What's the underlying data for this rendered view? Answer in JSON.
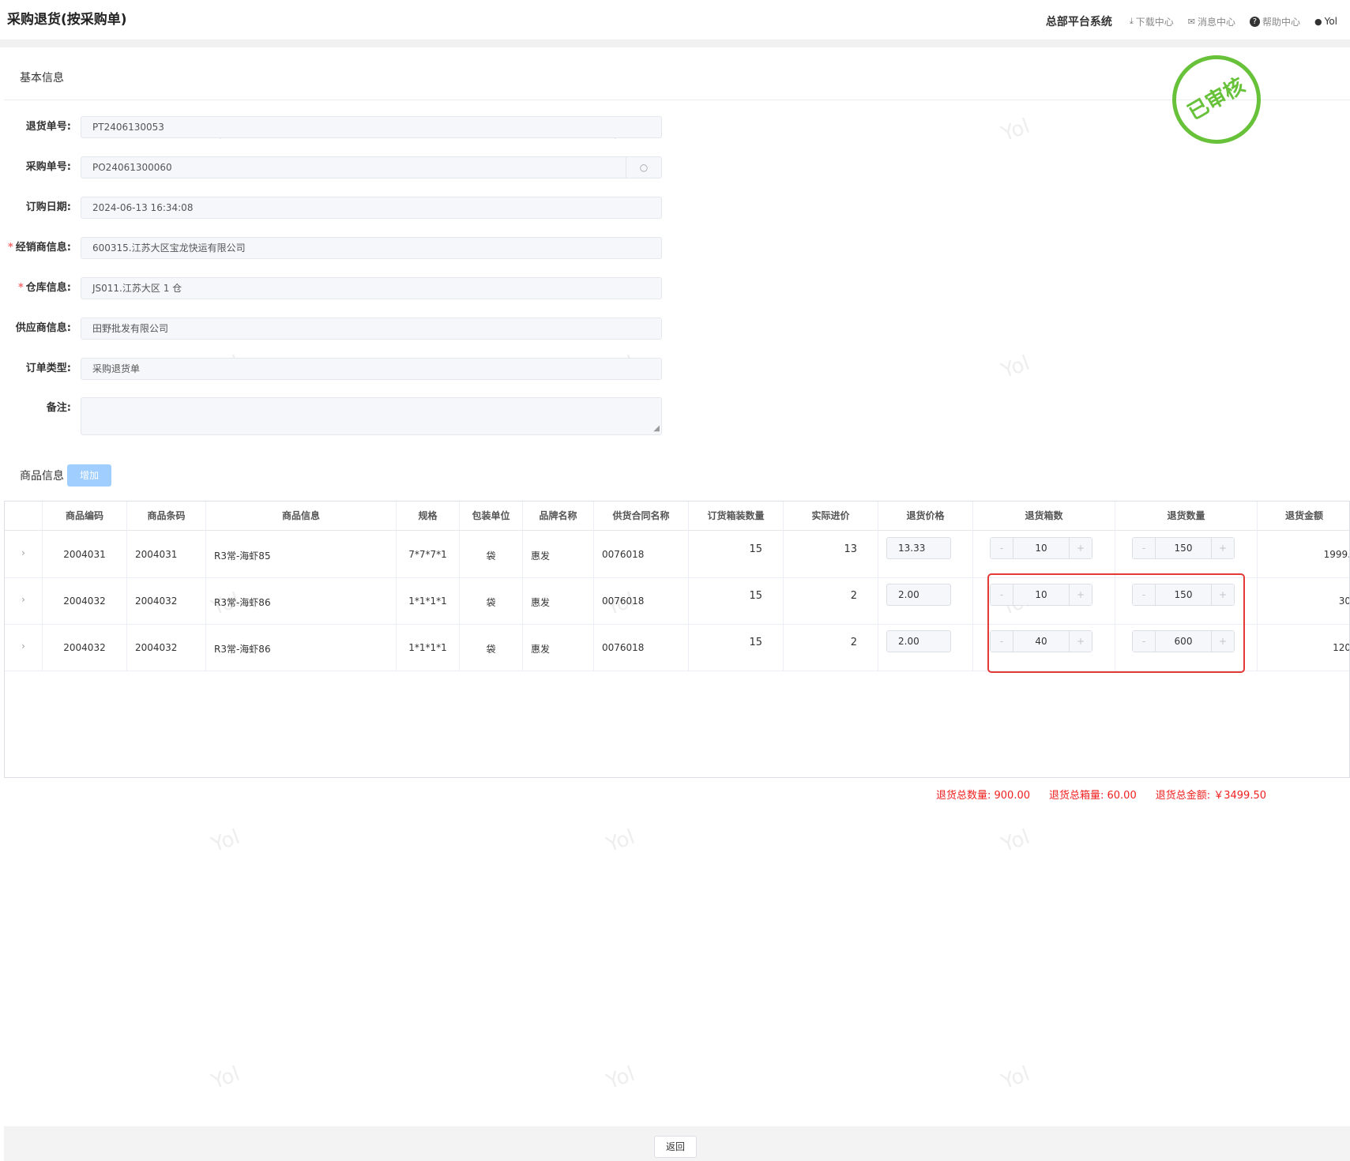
{
  "header": {
    "page_title": "采购退货(按采购单)",
    "system_name": "总部平台系统",
    "download": "下载中心",
    "messages": "消息中心",
    "help": "帮助中心",
    "user": "Yol"
  },
  "watermark": "Yol",
  "stamp": "已审核",
  "basic": {
    "title": "基本信息",
    "fields": [
      {
        "label": "退货单号:",
        "value": "PT2406130053",
        "required": false
      },
      {
        "label": "采购单号:",
        "value": "PO24061300060",
        "required": false
      },
      {
        "label": "订购日期:",
        "value": "2024-06-13 16:34:08",
        "required": false
      },
      {
        "label": "经销商信息:",
        "value": "600315.江苏大区宝龙快运有限公司",
        "required": true
      },
      {
        "label": "仓库信息:",
        "value": "JS011.江苏大区 1 仓",
        "required": true
      },
      {
        "label": "供应商信息:",
        "value": "田野批发有限公司",
        "required": false
      },
      {
        "label": "订单类型:",
        "value": "采购退货单",
        "required": false
      },
      {
        "label": "备注:",
        "value": "",
        "required": false
      }
    ],
    "required_mark": "*"
  },
  "goods": {
    "title": "商品信息",
    "add_label": "增加",
    "columns": [
      "",
      "商品编码",
      "商品条码",
      "商品信息",
      "规格",
      "包装单位",
      "品牌名称",
      "供货合同名称",
      "订货箱装数量",
      "实际进价",
      "退货价格",
      "退货箱数",
      "退货数量",
      "退货金额"
    ],
    "rows": [
      {
        "code": "2004031",
        "barcode": "2004031",
        "info": "R3常-海虾85",
        "spec": "7*7*7*1",
        "unit": "袋",
        "brand": "惠发",
        "contract": "0076018",
        "box_qty": "15",
        "cost": "13",
        "price": "13.33",
        "boxes": "10",
        "qty": "150",
        "amount": "1999."
      },
      {
        "code": "2004032",
        "barcode": "2004032",
        "info": "R3常-海虾86",
        "spec": "1*1*1*1",
        "unit": "袋",
        "brand": "惠发",
        "contract": "0076018",
        "box_qty": "15",
        "cost": "2",
        "price": "2.00",
        "boxes": "10",
        "qty": "150",
        "amount": "30"
      },
      {
        "code": "2004032",
        "barcode": "2004032",
        "info": "R3常-海虾86",
        "spec": "1*1*1*1",
        "unit": "袋",
        "brand": "惠发",
        "contract": "0076018",
        "box_qty": "15",
        "cost": "2",
        "price": "2.00",
        "boxes": "40",
        "qty": "600",
        "amount": "120"
      }
    ],
    "stepper_minus": "-",
    "stepper_plus": "+",
    "expand_glyph": "›"
  },
  "totals": {
    "qty": "退货总数量: 900.00",
    "boxes": "退货总箱量: 60.00",
    "amount": "退货总金额: ￥3499.50"
  },
  "footer": {
    "back_label": "返回"
  },
  "colors": {
    "stamp": "#67c23a",
    "highlight": "#e53935",
    "total_text": "#f02020",
    "add_button": "#a0cfff"
  }
}
